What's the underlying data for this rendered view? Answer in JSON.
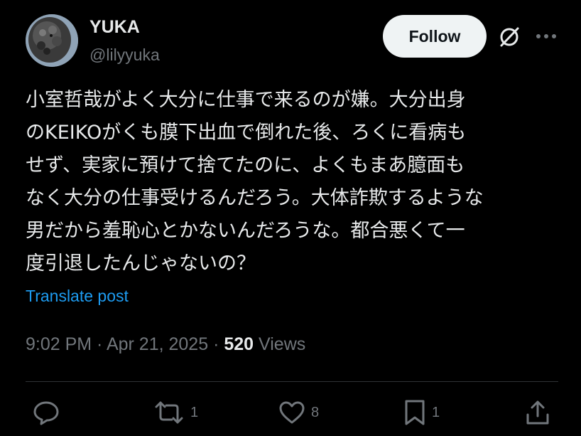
{
  "author": {
    "display_name": "YUKA",
    "handle": "@lilyyuka"
  },
  "header": {
    "follow_label": "Follow",
    "grok_icon": "grok-icon",
    "more_icon": "more-icon"
  },
  "post": {
    "lines": [
      "小室哲哉がよく大分に仕事で来るのが嫌。大分出身",
      "のKEIKOがくも膜下出血で倒れた後、ろくに看病も",
      "せず、実家に預けて捨てたのに、よくもまあ臆面も",
      "なく大分の仕事受けるんだろう。大体詐欺するような",
      "男だから羞恥心とかないんだろうな。都合悪くて一",
      "度引退したんじゃないの？"
    ],
    "translate_label": "Translate post"
  },
  "meta": {
    "time": "9:02 PM",
    "sep1": " · ",
    "date": "Apr 21, 2025",
    "sep2": " · ",
    "views_count": "520",
    "views_label": " Views"
  },
  "actions": {
    "reply_count": "",
    "repost_count": "1",
    "like_count": "8",
    "bookmark_count": "1"
  },
  "colors": {
    "background": "#000000",
    "text": "#e7e9ea",
    "muted": "#71767b",
    "link": "#1d9bf0",
    "follow_bg": "#eff3f4"
  }
}
